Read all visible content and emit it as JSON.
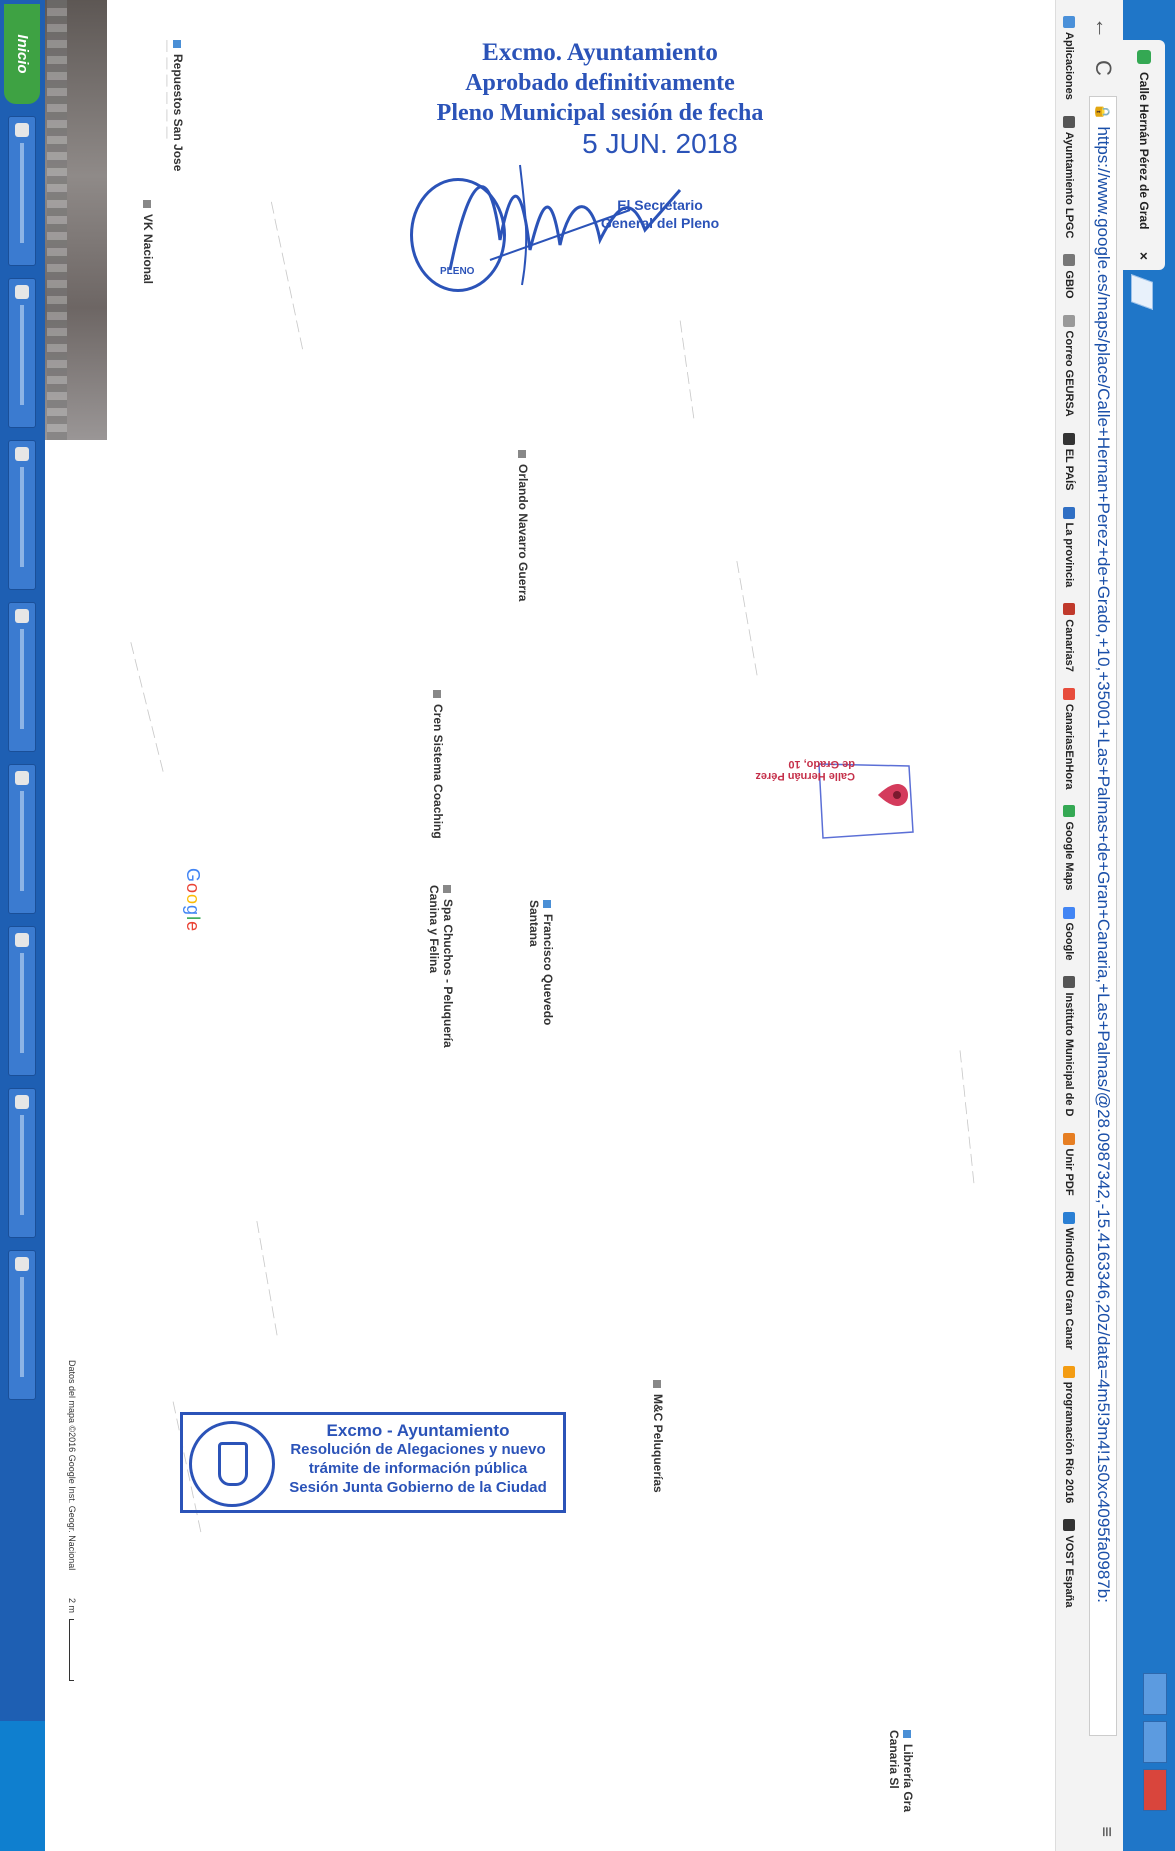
{
  "browser": {
    "tab_title": "Calle Hernán Pérez de Grad",
    "tab_close": "×",
    "back": "←",
    "reload": "C",
    "url": "https://www.google.es/maps/place/Calle+Hernan+Perez+de+Grado,+10,+35001+Las+Palmas+de+Gran+Canaria,+Las+Palmas/@28.0987342,-15.4163346,20z/data=4m5!3m4!1s0xc4095fa0987b:",
    "menu": "≡"
  },
  "bookmarks": [
    {
      "label": "Aplicaciones",
      "icon": "apps-icon",
      "color": "#4a90d9"
    },
    {
      "label": "Ayuntamiento LPGC",
      "icon": "city-hall-icon",
      "color": "#555555"
    },
    {
      "label": "GBIO",
      "icon": "globe-icon",
      "color": "#777777"
    },
    {
      "label": "Correo GEURSA",
      "icon": "page-icon",
      "color": "#999999"
    },
    {
      "label": "EL PAÍS",
      "icon": "newspaper-icon",
      "color": "#333333"
    },
    {
      "label": "La provincia",
      "icon": "lp-icon",
      "color": "#2f6fc4"
    },
    {
      "label": "Canarias7",
      "icon": "c7-icon",
      "color": "#c0392b"
    },
    {
      "label": "CanariasEnHora",
      "icon": "clock-icon",
      "color": "#e74c3c"
    },
    {
      "label": "Google Maps",
      "icon": "maps-icon",
      "color": "#34a853"
    },
    {
      "label": "Google",
      "icon": "google-icon",
      "color": "#4285f4"
    },
    {
      "label": "Instituto Municipal de D",
      "icon": "institute-icon",
      "color": "#555555"
    },
    {
      "label": "Unir PDF",
      "icon": "pdf-icon",
      "color": "#e67e22"
    },
    {
      "label": "WindGURU Gran Canar",
      "icon": "wind-icon",
      "color": "#2a7fd4"
    },
    {
      "label": "programación Río 2016",
      "icon": "rio-icon",
      "color": "#f39c12"
    },
    {
      "label": "VOST España",
      "icon": "vost-icon",
      "color": "#333333"
    }
  ],
  "map": {
    "places": [
      {
        "label": "Repuestos San Jose"
      },
      {
        "label": "VK Nacional"
      },
      {
        "label": "Orlando Navarro Guerra"
      },
      {
        "label": "Cren Sistema Coaching"
      },
      {
        "label": "Spa Chuchos - Peluquería Canina y Felina"
      },
      {
        "label": "Francisco Quevedo Santana"
      },
      {
        "label": "M&C Peluquerías"
      },
      {
        "label": "Librería Gra Canaria Sl"
      }
    ],
    "selected_pin": "Calle Hernán Pérez de Grado, 10",
    "google_logo": "Google",
    "attribution": "Datos del mapa ©2016 Google Inst. Geogr. Nacional",
    "scale": "2 m"
  },
  "stamp_approval": {
    "line1": "Excmo. Ayuntamiento",
    "line2": "Aprobado definitivamente",
    "line3": "Pleno Municipal sesión de fecha",
    "date": "5 JUN. 2018",
    "role_line1": "El Secretario",
    "role_line2": "General del Pleno",
    "seal_text": "PLENO"
  },
  "stamp_resolution": {
    "line1": "Excmo - Ayuntamiento",
    "line2": "Resolución de Alegaciones y nuevo",
    "line3": "trámite de información pública",
    "line4": "Sesión Junta Gobierno de la Ciudad"
  },
  "taskbar": {
    "start_label": "Inicio"
  },
  "colors": {
    "stamp_blue": "#2b53b8",
    "pin_red": "#d43b5c",
    "taskbar_blue": "#1e5fb3",
    "start_green": "#3ea243"
  }
}
